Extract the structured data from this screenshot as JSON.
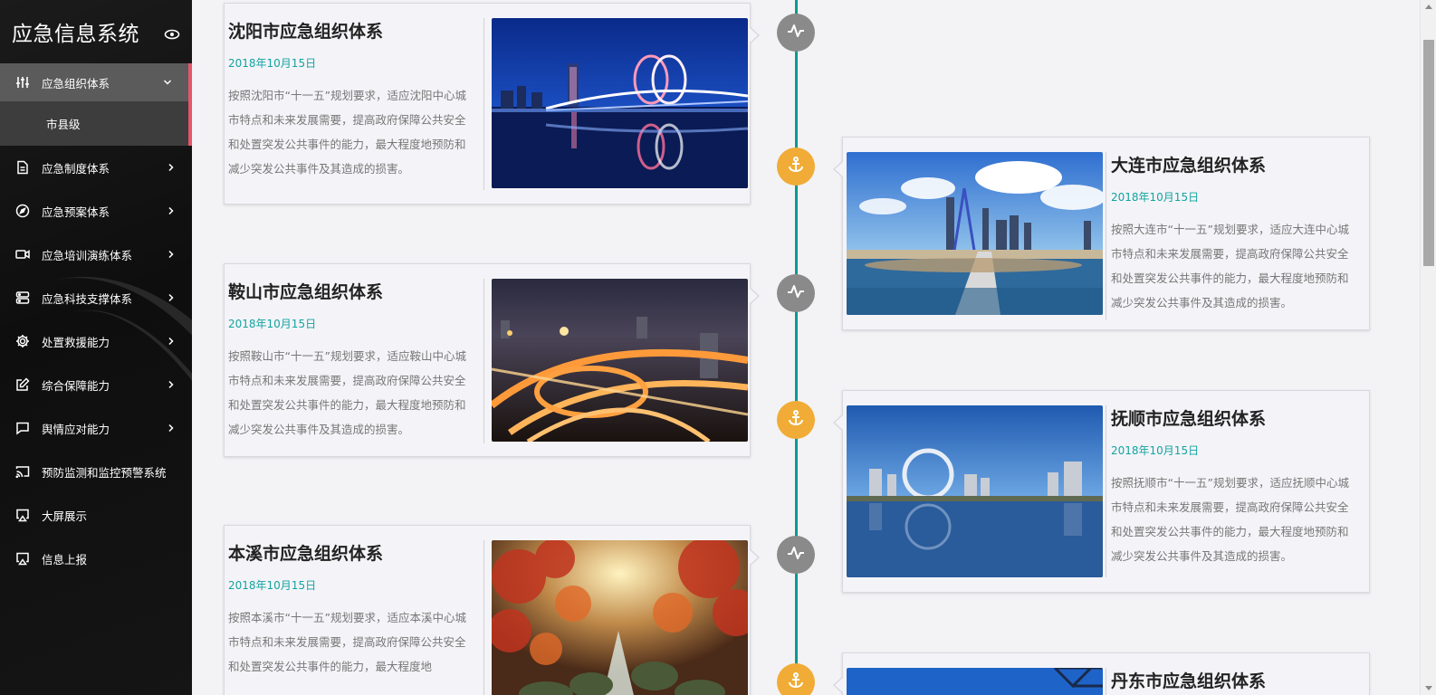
{
  "app": {
    "title": "应急信息系统",
    "icon": "eye-icon"
  },
  "sidebar": {
    "items": [
      {
        "label": "应急组织体系",
        "icon": "sliders-icon",
        "expanded": true,
        "children": [
          {
            "label": "市县级"
          }
        ]
      },
      {
        "label": "应急制度体系",
        "icon": "document-icon"
      },
      {
        "label": "应急预案体系",
        "icon": "compass-icon"
      },
      {
        "label": "应急培训演练体系",
        "icon": "video-icon"
      },
      {
        "label": "应急科技支撑体系",
        "icon": "server-icon"
      },
      {
        "label": "处置救援能力",
        "icon": "gear-icon"
      },
      {
        "label": "综合保障能力",
        "icon": "edit-icon"
      },
      {
        "label": "舆情应对能力",
        "icon": "chat-icon"
      },
      {
        "label": "预防监测和监控预警系统",
        "icon": "cast-icon"
      },
      {
        "label": "大屏展示",
        "icon": "airplay-icon"
      },
      {
        "label": "信息上报",
        "icon": "airplay-icon"
      }
    ],
    "colors": {
      "active_bg": "#5b5b5b",
      "accent": "#e5566a"
    }
  },
  "timeline": {
    "colors": {
      "line": "#0a9a8f",
      "date": "#13a3a0",
      "node_gray": "#8a8a8a",
      "node_orange": "#f0ac36"
    },
    "entries": [
      {
        "title": "沈阳市应急组织体系",
        "date": "2018年10月15日",
        "desc": "按照沈阳市“十一五”规划要求，适应沈阳中心城市特点和未来发展需要，提高政府保障公共安全和处置突发公共事件的能力，最大程度地预防和减少突发公共事件及其造成的损害。",
        "image": "night-bridge-reflection",
        "node_icon": "activity-icon"
      },
      {
        "title": "大连市应急组织体系",
        "date": "2018年10月15日",
        "desc": "按照大连市“十一五”规划要求，适应大连中心城市特点和未来发展需要，提高政府保障公共安全和处置突发公共事件的能力，最大程度地预防和减少突发公共事件及其造成的损害。",
        "image": "coastal-city-bridge",
        "node_icon": "anchor-icon"
      },
      {
        "title": "鞍山市应急组织体系",
        "date": "2018年10月15日",
        "desc": "按照鞍山市“十一五”规划要求，适应鞍山中心城市特点和未来发展需要，提高政府保障公共安全和处置突发公共事件的能力，最大程度地预防和减少突发公共事件及其造成的损害。",
        "image": "night-interchange",
        "node_icon": "activity-icon"
      },
      {
        "title": "抚顺市应急组织体系",
        "date": "2018年10月15日",
        "desc": "按照抚顺市“十一五”规划要求，适应抚顺中心城市特点和未来发展需要，提高政府保障公共安全和处置突发公共事件的能力，最大程度地预防和减少突发公共事件及其造成的损害。",
        "image": "ring-landmark-lake",
        "node_icon": "anchor-icon"
      },
      {
        "title": "本溪市应急组织体系",
        "date": "2018年10月15日",
        "desc": "按照本溪市“十一五”规划要求，适应本溪中心城市特点和未来发展需要，提高政府保障公共安全和处置突发公共事件的能力，最大程度地",
        "image": "autumn-forest-stream",
        "node_icon": "activity-icon"
      },
      {
        "title": "丹东市应急组织体系",
        "date": "",
        "desc": "",
        "image": "blue-sky-bridge",
        "node_icon": "anchor-icon"
      }
    ]
  }
}
